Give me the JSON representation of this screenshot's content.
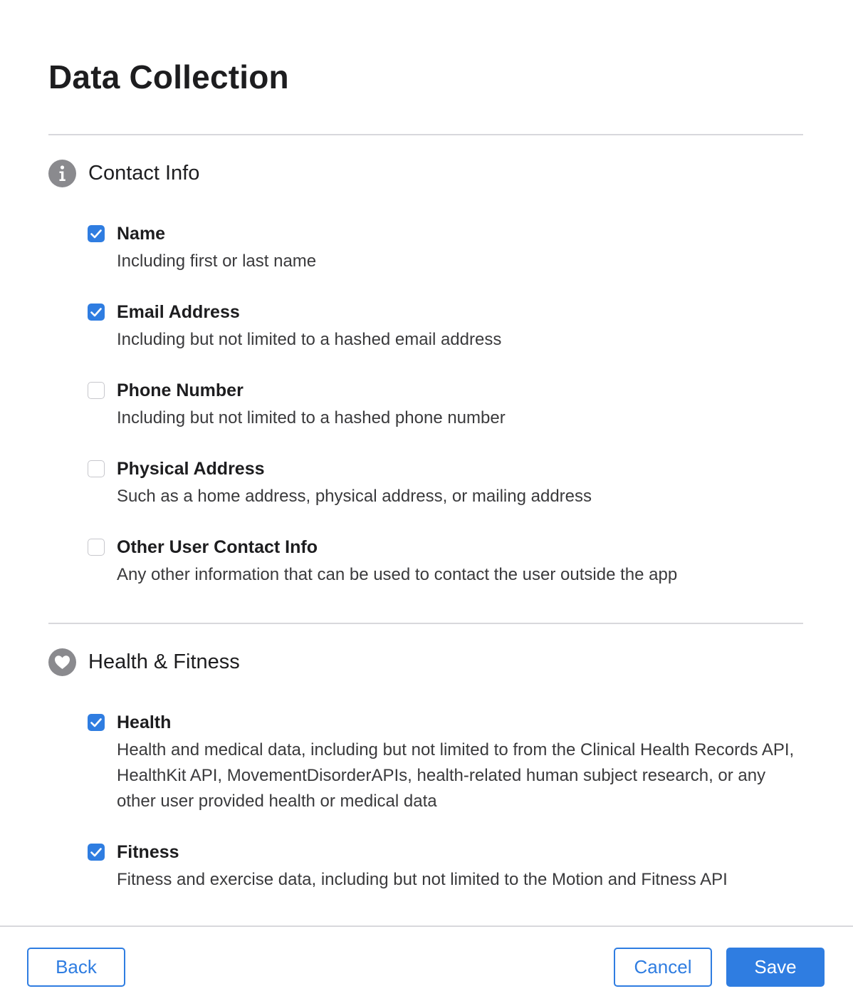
{
  "page": {
    "title": "Data Collection"
  },
  "sections": [
    {
      "title": "Contact Info",
      "icon": "info-icon",
      "options": [
        {
          "label": "Name",
          "description": "Including first or last name",
          "checked": true
        },
        {
          "label": "Email Address",
          "description": "Including but not limited to a hashed email address",
          "checked": true
        },
        {
          "label": "Phone Number",
          "description": "Including but not limited to a hashed phone number",
          "checked": false
        },
        {
          "label": "Physical Address",
          "description": "Such as a home address, physical address, or mailing address",
          "checked": false
        },
        {
          "label": "Other User Contact Info",
          "description": "Any other information that can be used to contact the user outside the app",
          "checked": false
        }
      ]
    },
    {
      "title": "Health & Fitness",
      "icon": "heart-icon",
      "options": [
        {
          "label": "Health",
          "description": "Health and medical data, including but not limited to from the Clinical Health Records API, HealthKit API, MovementDisorderAPIs, health-related human subject research, or any other user provided health or medical data",
          "checked": true
        },
        {
          "label": "Fitness",
          "description": "Fitness and exercise data, including but not limited to the Motion and Fitness API",
          "checked": true
        }
      ]
    }
  ],
  "footer": {
    "back_label": "Back",
    "cancel_label": "Cancel",
    "save_label": "Save"
  },
  "colors": {
    "accent": "#2f7de1",
    "icon_gray": "#8a8a8e",
    "divider": "#d8d8dc"
  }
}
